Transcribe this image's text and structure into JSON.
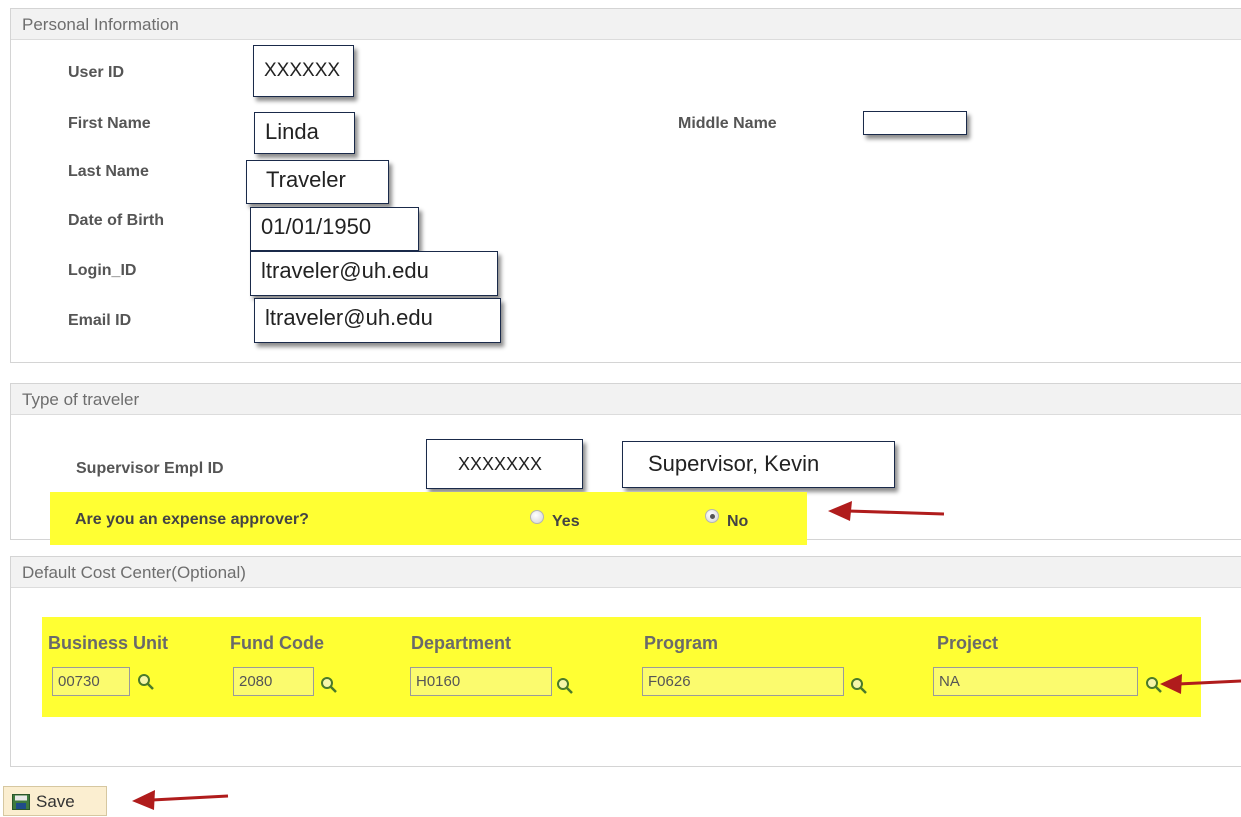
{
  "personal": {
    "title": "Personal Information",
    "user_id_label": "User ID",
    "user_id_value": "XXXXXX",
    "first_name_label": "First Name",
    "first_name_value": "Linda",
    "middle_name_label": "Middle Name",
    "middle_name_value": "",
    "last_name_label": "Last Name",
    "last_name_value": "Traveler",
    "dob_label": "Date of Birth",
    "dob_value": "01/01/1950",
    "login_label": "Login_ID",
    "login_value": "ltraveler@uh.edu",
    "email_label": "Email ID",
    "email_value": "ltraveler@uh.edu"
  },
  "traveler_type": {
    "title": "Type of traveler",
    "supervisor_label": "Supervisor Empl ID",
    "supervisor_id": "XXXXXXX",
    "supervisor_name": "Supervisor, Kevin",
    "approver_question": "Are you an expense approver?",
    "yes_label": "Yes",
    "no_label": "No",
    "selected": "No"
  },
  "cost_center": {
    "title": "Default Cost Center(Optional)",
    "business_unit_label": "Business Unit",
    "business_unit_value": "00730",
    "fund_code_label": "Fund Code",
    "fund_code_value": "2080",
    "department_label": "Department",
    "department_value": "H0160",
    "program_label": "Program",
    "program_value": "F0626",
    "project_label": "Project",
    "project_value": "NA"
  },
  "toolbar": {
    "save_label": "Save"
  },
  "colors": {
    "highlight": "#ffff33",
    "arrow": "#b01c1c",
    "callout_border": "#1a2a4a"
  },
  "icons": {
    "lookup": "magnifier-icon",
    "save": "floppy-disk-icon",
    "annotation": "red-arrow-icon"
  }
}
